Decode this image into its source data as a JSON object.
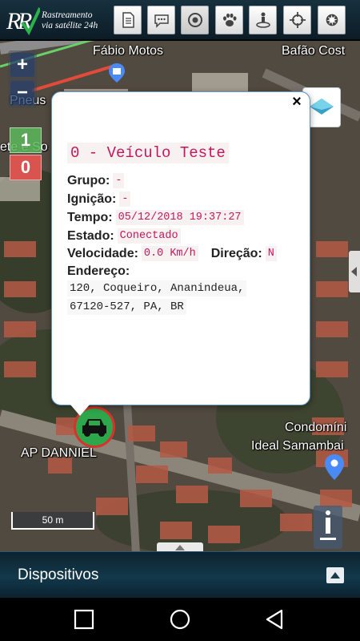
{
  "header": {
    "logo_line1": "Rastreamento",
    "logo_line2": "via satélite 24h",
    "toolbar": [
      {
        "icon": "document-icon",
        "active": false
      },
      {
        "icon": "chat-icon",
        "active": false
      },
      {
        "icon": "target-icon",
        "active": true
      },
      {
        "icon": "paw-icon",
        "active": false
      },
      {
        "icon": "map-person-icon",
        "active": false
      },
      {
        "icon": "crosshair-icon",
        "active": false
      },
      {
        "icon": "gear-icon",
        "active": false
      }
    ]
  },
  "map": {
    "labels": {
      "fabio": "Fábio Motos",
      "bafao": "Bafão Cost",
      "pneus": "Pneus",
      "ete": "ete e So",
      "ap": "AP DANNIEL",
      "condominio1": "Condomíni",
      "condominio2": "Ideal Samambai"
    },
    "zoom_in": "+",
    "zoom_out": "−",
    "counter_green": "1",
    "counter_red": "0",
    "scale": "50 m"
  },
  "popup": {
    "close": "×",
    "title": "0 - Veículo Teste",
    "grupo_label": "Grupo:",
    "grupo_value": "-",
    "ignicao_label": "Ignição:",
    "ignicao_value": "-",
    "tempo_label": "Tempo:",
    "tempo_value": "05/12/2018 19:37:27",
    "estado_label": "Estado:",
    "estado_value": "Conectado",
    "velocidade_label": "Velocidade:",
    "velocidade_value": "0.0 Km/h",
    "direcao_label": "Direção:",
    "direcao_value": "N",
    "endereco_label": "Endereço:",
    "endereco_line1": "120, Coqueiro, Ananindeua,",
    "endereco_line2": "67120-527, PA, BR"
  },
  "footer": {
    "dispositivos": "Dispositivos"
  },
  "colors": {
    "accent_text": "#c2185b",
    "counter_green": "#5cb85c",
    "counter_red": "#d9534f",
    "marker": "#2ea64b"
  }
}
